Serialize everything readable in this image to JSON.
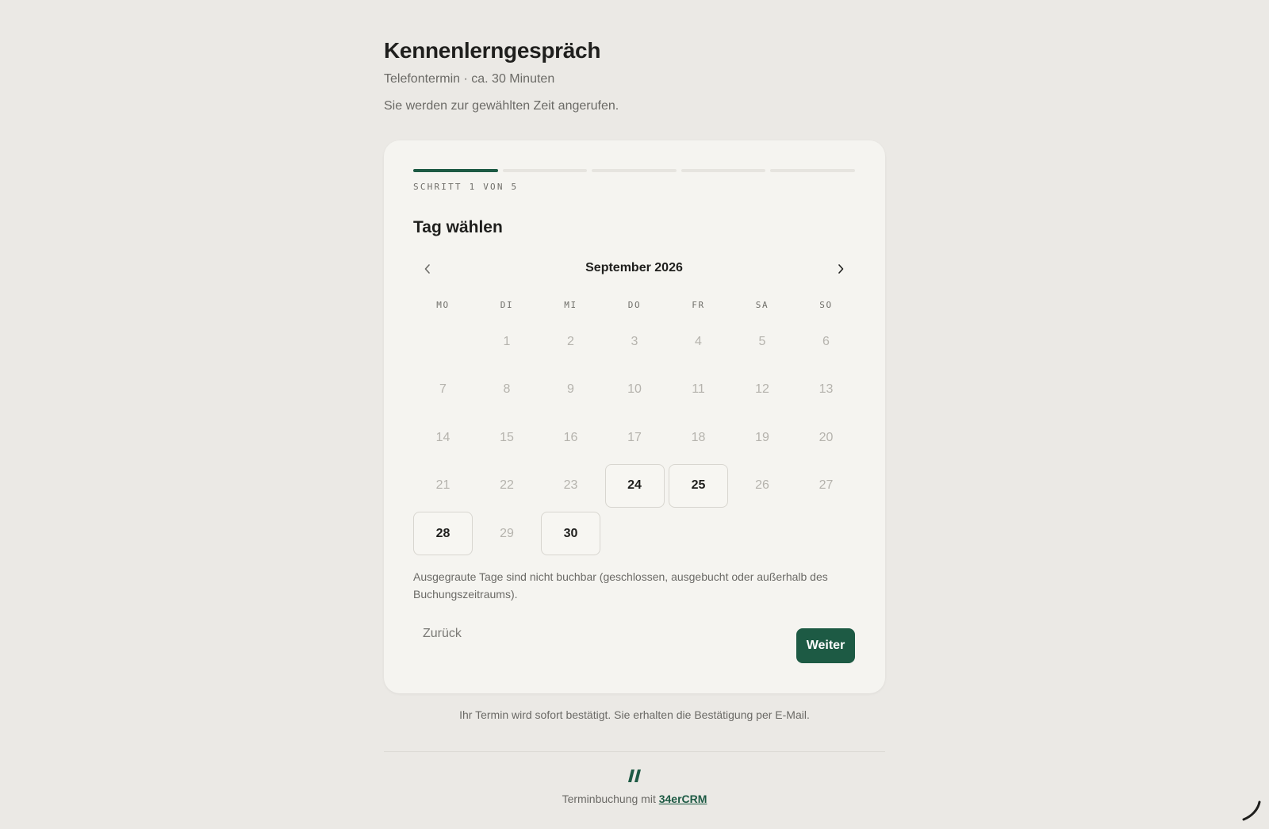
{
  "header": {
    "title": "Kennenlerngespräch",
    "meta": "Telefontermin · ca. 30 Minuten",
    "description": "Sie werden zur gewählten Zeit angerufen."
  },
  "progress": {
    "total_steps": 5,
    "current_step": 1,
    "label": "SCHRITT 1 VON 5"
  },
  "step": {
    "title": "Tag wählen"
  },
  "calendar": {
    "month_label": "September 2026",
    "prev_icon": "chevron-left-icon",
    "next_icon": "chevron-right-icon",
    "weekdays": [
      "MO",
      "DI",
      "MI",
      "DO",
      "FR",
      "SA",
      "SO"
    ],
    "first_weekday_offset": 1,
    "days": [
      {
        "day": "1",
        "available": false
      },
      {
        "day": "2",
        "available": false
      },
      {
        "day": "3",
        "available": false
      },
      {
        "day": "4",
        "available": false
      },
      {
        "day": "5",
        "available": false
      },
      {
        "day": "6",
        "available": false
      },
      {
        "day": "7",
        "available": false
      },
      {
        "day": "8",
        "available": false
      },
      {
        "day": "9",
        "available": false
      },
      {
        "day": "10",
        "available": false
      },
      {
        "day": "11",
        "available": false
      },
      {
        "day": "12",
        "available": false
      },
      {
        "day": "13",
        "available": false
      },
      {
        "day": "14",
        "available": false
      },
      {
        "day": "15",
        "available": false
      },
      {
        "day": "16",
        "available": false
      },
      {
        "day": "17",
        "available": false
      },
      {
        "day": "18",
        "available": false
      },
      {
        "day": "19",
        "available": false
      },
      {
        "day": "20",
        "available": false
      },
      {
        "day": "21",
        "available": false
      },
      {
        "day": "22",
        "available": false
      },
      {
        "day": "23",
        "available": false
      },
      {
        "day": "24",
        "available": true
      },
      {
        "day": "25",
        "available": true
      },
      {
        "day": "26",
        "available": false
      },
      {
        "day": "27",
        "available": false
      },
      {
        "day": "28",
        "available": true
      },
      {
        "day": "29",
        "available": false
      },
      {
        "day": "30",
        "available": true
      }
    ],
    "hint": "Ausgegraute Tage sind nicht buchbar (geschlossen, ausgebucht oder außerhalb des Buchungszeitraums)."
  },
  "actions": {
    "back_label": "Zurück",
    "next_label": "Weiter"
  },
  "confirm_note": "Ihr Termin wird sofort bestätigt. Sie erhalten die Bestätigung per E-Mail.",
  "footer": {
    "logo_icon": "brand-slashes-icon",
    "prefix": "Terminbuchung mit",
    "link_label": "34erCRM"
  },
  "colors": {
    "accent": "#1d5a44",
    "background": "#ebe9e5",
    "card": "#f5f4f0",
    "muted_text": "#6b6a66",
    "disabled_day": "#b5b3ad"
  }
}
